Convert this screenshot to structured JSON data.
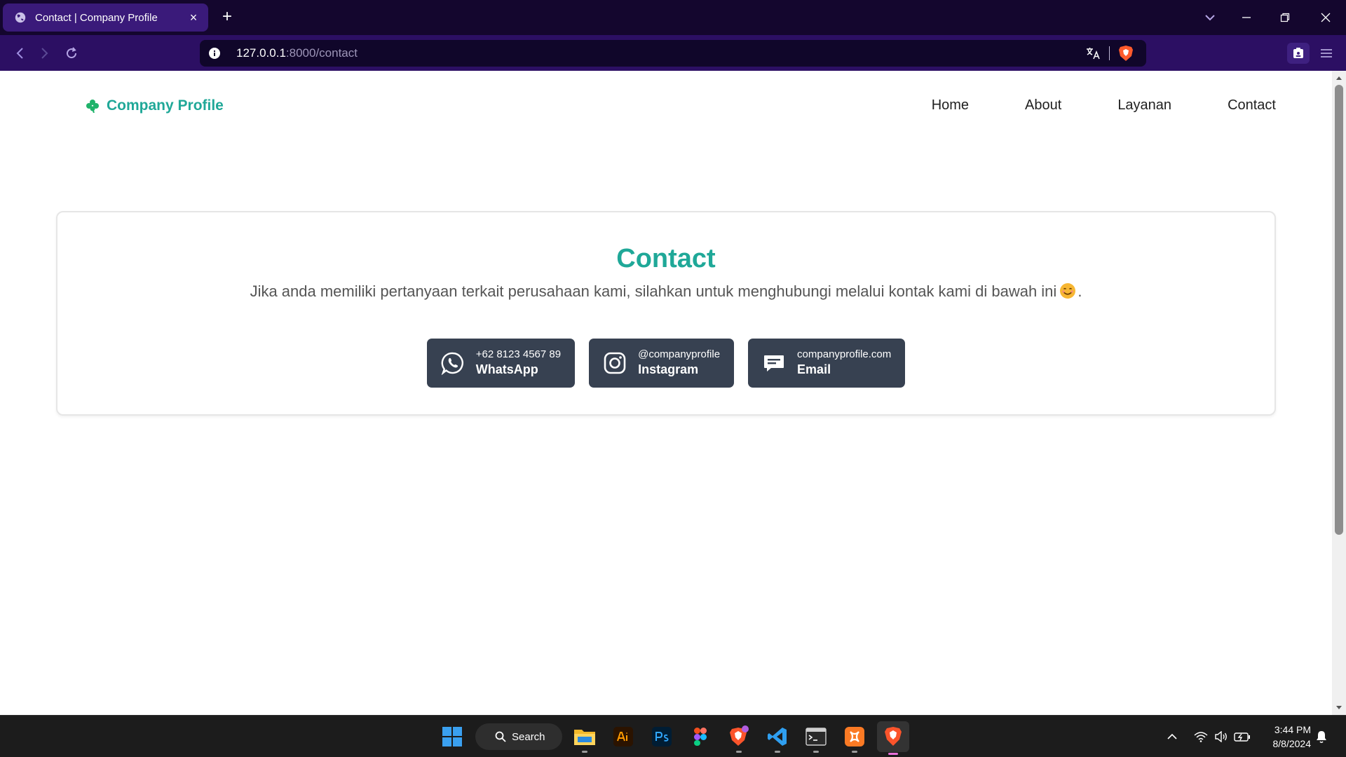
{
  "browser": {
    "tab_title": "Contact | Company Profile",
    "new_tab_symbol": "+",
    "url_host": "127.0.0.1",
    "url_rest": ":8000/contact"
  },
  "site": {
    "brand": "Company Profile",
    "nav": [
      "Home",
      "About",
      "Layanan",
      "Contact"
    ]
  },
  "contact": {
    "title": "Contact",
    "lead": "Jika anda memiliki pertanyaan terkait perusahaan kami, silahkan untuk menghubungi melalui kontak kami di bawah ini",
    "lead_end": ".",
    "buttons": [
      {
        "small": "+62 8123 4567 89",
        "big": "WhatsApp",
        "icon": "whatsapp-icon"
      },
      {
        "small": "@companyprofile",
        "big": "Instagram",
        "icon": "instagram-icon"
      },
      {
        "small": "companyprofile.com",
        "big": "Email",
        "icon": "message-icon"
      }
    ]
  },
  "taskbar": {
    "search_label": "Search",
    "time": "3:44 PM",
    "date": "8/8/2024"
  },
  "colors": {
    "accent": "#1fa898",
    "button_bg": "#374151",
    "tab_active": "#3a1a7a",
    "address_bar": "#2c0f63"
  }
}
